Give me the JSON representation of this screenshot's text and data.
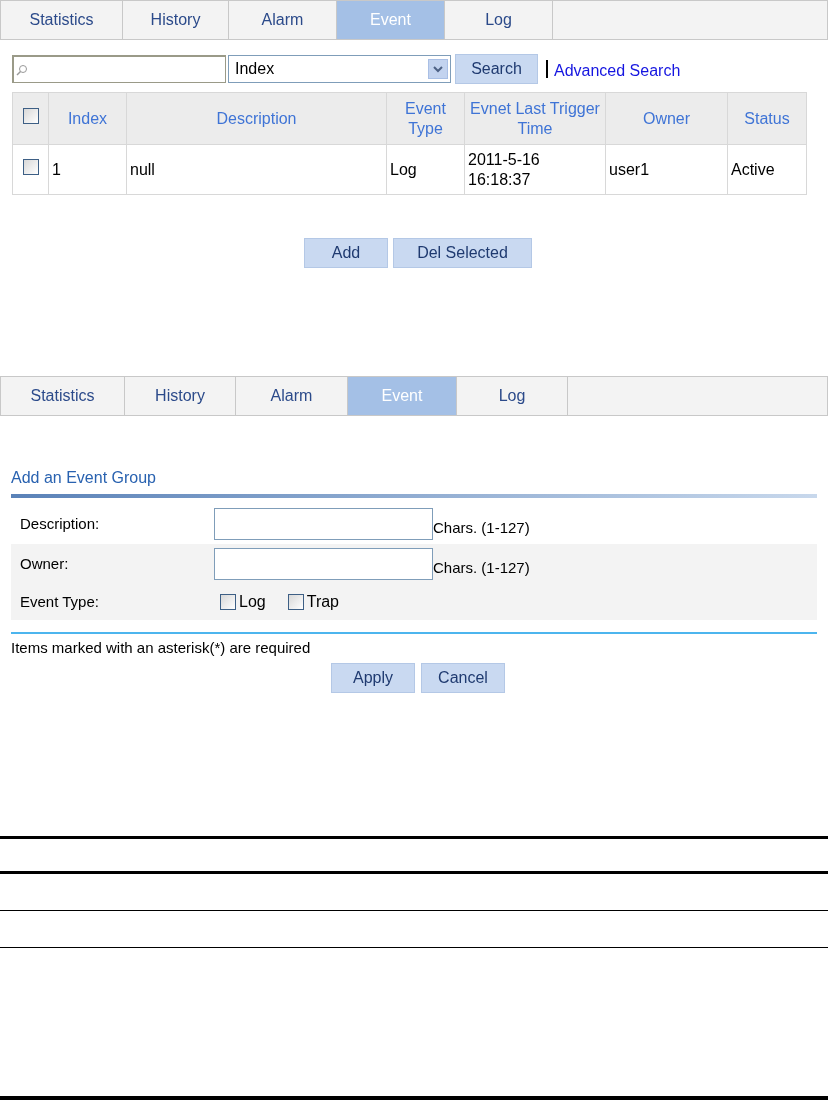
{
  "event_list": {
    "tabs": [
      {
        "label": "Statistics",
        "selected": false
      },
      {
        "label": "History",
        "selected": false
      },
      {
        "label": "Alarm",
        "selected": false
      },
      {
        "label": "Event",
        "selected": true
      },
      {
        "label": "Log",
        "selected": false
      }
    ],
    "search": {
      "filter": "Index",
      "button": "Search",
      "advanced_link": "Advanced Search"
    },
    "table": {
      "header_checked": false,
      "columns": [
        "Index",
        "Description",
        "Event Type",
        "Evnet Last Trigger Time",
        "Owner",
        "Status"
      ],
      "rows": [
        {
          "checked": false,
          "cells": [
            "1",
            "null",
            "Log",
            "2011-5-16 16:18:37",
            "user1",
            "Active"
          ]
        }
      ]
    },
    "buttons": [
      "Add",
      "Del Selected"
    ]
  },
  "add_event": {
    "tabs": [
      {
        "label": "Statistics",
        "selected": false
      },
      {
        "label": "History",
        "selected": false
      },
      {
        "label": "Alarm",
        "selected": false
      },
      {
        "label": "Event",
        "selected": true
      },
      {
        "label": "Log",
        "selected": false
      }
    ],
    "section_title": "Add an Event Group",
    "fields": [
      {
        "kind": "text",
        "label": "Description:",
        "hint": "Chars. (1-127)"
      },
      {
        "kind": "text",
        "label": "Owner:",
        "hint": "Chars. (1-127)"
      },
      {
        "kind": "checkboxes",
        "label": "Event Type:",
        "options": [
          {
            "label": "Log",
            "checked": false
          },
          {
            "label": "Trap",
            "checked": false
          }
        ]
      }
    ],
    "note": "Items marked with an asterisk(*) are required",
    "buttons": [
      "Apply",
      "Cancel"
    ]
  }
}
